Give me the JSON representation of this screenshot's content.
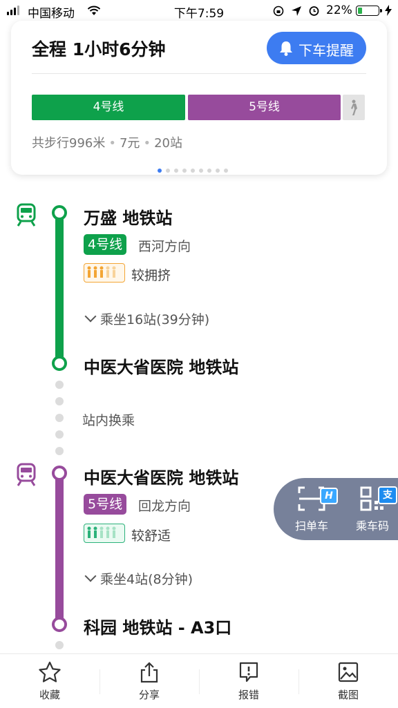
{
  "status_bar": {
    "carrier": "中国移动",
    "time": "下午7:59",
    "battery_percent": "22%",
    "battery_level": 0.22
  },
  "summary": {
    "title": "全程  1小时6分钟",
    "alarm_button": "下车提醒",
    "segments": [
      {
        "label": "4号线",
        "color": "#0ea14b"
      },
      {
        "label": "5号线",
        "color": "#974b9c"
      }
    ],
    "walk_icon": "walk-icon",
    "walk": "共步行996米",
    "fare": "7元",
    "stops": "20站",
    "page_count": 9,
    "page_active": 1
  },
  "route": {
    "leg1": {
      "line_color": "#0ea14b",
      "board_station": "万盛 地铁站",
      "line_badge": "4号线",
      "direction": "西河方向",
      "crowd_label": "较拥挤",
      "crowd_color": "#f3a534",
      "ride_info": "乘坐16站(39分钟)",
      "alight_station": "中医大省医院 地铁站"
    },
    "transfer_text": "站内换乘",
    "leg2": {
      "line_color": "#974b9c",
      "board_station": "中医大省医院 地铁站",
      "line_badge": "5号线",
      "direction": "回龙方向",
      "crowd_label": "较舒适",
      "crowd_color": "#2bb27a",
      "ride_info": "乘坐4站(8分钟)",
      "alight_station": "科园 地铁站 - A3口"
    }
  },
  "float_panel": {
    "scan_bike": "扫单车",
    "scan_badge": "H",
    "ride_code": "乘车码",
    "ride_code_badge": "支"
  },
  "toolbar": {
    "favorite": "收藏",
    "share": "分享",
    "report": "报错",
    "screenshot": "截图"
  }
}
